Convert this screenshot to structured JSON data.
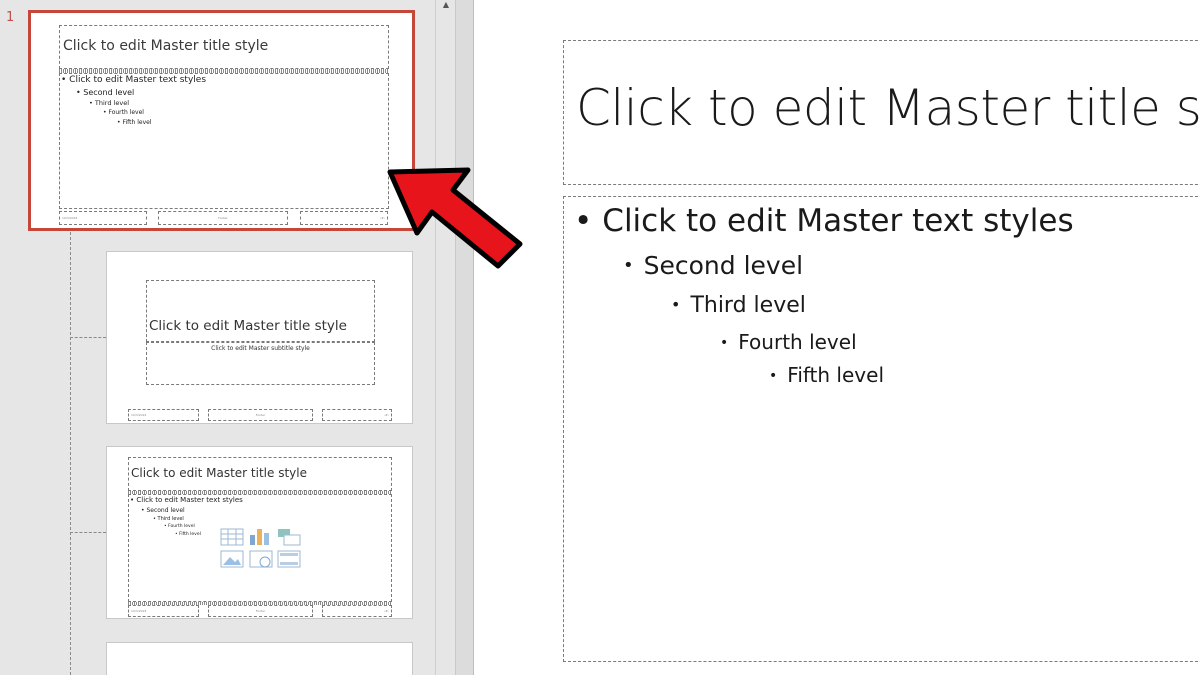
{
  "thumbnails": {
    "slide_number": "1",
    "master": {
      "title": "Click to edit Master title style",
      "levels": [
        "Click to edit Master text styles",
        "Second level",
        "Third level",
        "Fourth level",
        "Fifth level"
      ],
      "footer": {
        "date": "10/3/2024",
        "center": "Footer",
        "number": "‹#›"
      }
    },
    "title_layout": {
      "title": "Click to edit Master title style",
      "subtitle": "Click to edit Master subtitle style",
      "footer": {
        "date": "10/3/2024",
        "center": "Footer",
        "number": "‹#›"
      }
    },
    "content_layout": {
      "title": "Click to edit Master title style",
      "levels": [
        "Click to edit Master text styles",
        "Second level",
        "Third level",
        "Fourth level",
        "Fifth level"
      ],
      "footer": {
        "date": "10/3/2024",
        "center": "Footer",
        "number": "‹#›"
      }
    }
  },
  "main": {
    "title": "Click to edit Master title style",
    "levels": [
      "Click to edit Master text styles",
      "Second level",
      "Third level",
      "Fourth level",
      "Fifth level"
    ]
  },
  "colors": {
    "selection": "#c4473a",
    "arrow": "#e8141c"
  },
  "icons": [
    "scroll-up-icon",
    "table-icon",
    "chart-icon",
    "smartart-icon",
    "picture-icon",
    "online-picture-icon",
    "video-icon",
    "red-arrow-icon"
  ]
}
